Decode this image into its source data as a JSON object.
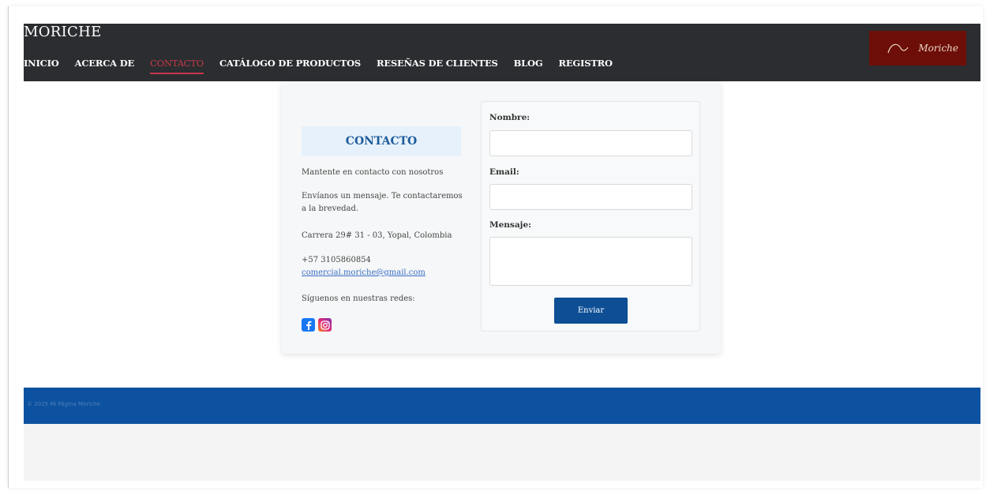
{
  "header": {
    "brand": "MORICHE",
    "logo_text": "Moriche",
    "nav": [
      {
        "label": "INICIO",
        "active": false
      },
      {
        "label": "ACERCA DE",
        "active": false
      },
      {
        "label": "CONTACTO",
        "active": true
      },
      {
        "label": "CATÁLOGO DE PRODUCTOS",
        "active": false
      },
      {
        "label": "RESEÑAS DE CLIENTES",
        "active": false
      },
      {
        "label": "BLOG",
        "active": false
      },
      {
        "label": "REGISTRO",
        "active": false
      }
    ]
  },
  "contact": {
    "title": "CONTACTO",
    "line1": "Mantente en contacto con nosotros",
    "line2": "Envíanos un mensaje. Te contactaremos a la brevedad.",
    "address": "Carrera 29# 31 - 03, Yopal, Colombia",
    "phone": "+57 3105860854",
    "email": "comercial.moriche@gmail.com",
    "social_label": "Síguenos en nuestras redes:",
    "socials": [
      "facebook-icon",
      "instagram-icon"
    ]
  },
  "form": {
    "name_label": "Nombre:",
    "name_value": "",
    "email_label": "Email:",
    "email_value": "",
    "message_label": "Mensaje:",
    "message_value": "",
    "submit_label": "Enviar"
  },
  "footer": {
    "text": "© 2025 Mi Página Moriche"
  },
  "colors": {
    "topbar": "#2b2d30",
    "active_nav": "#c8394a",
    "logo_bg": "#6d0f08",
    "contact_title": "#1d5b9a",
    "submit": "#0d4e95",
    "footer": "#0d52a0"
  }
}
